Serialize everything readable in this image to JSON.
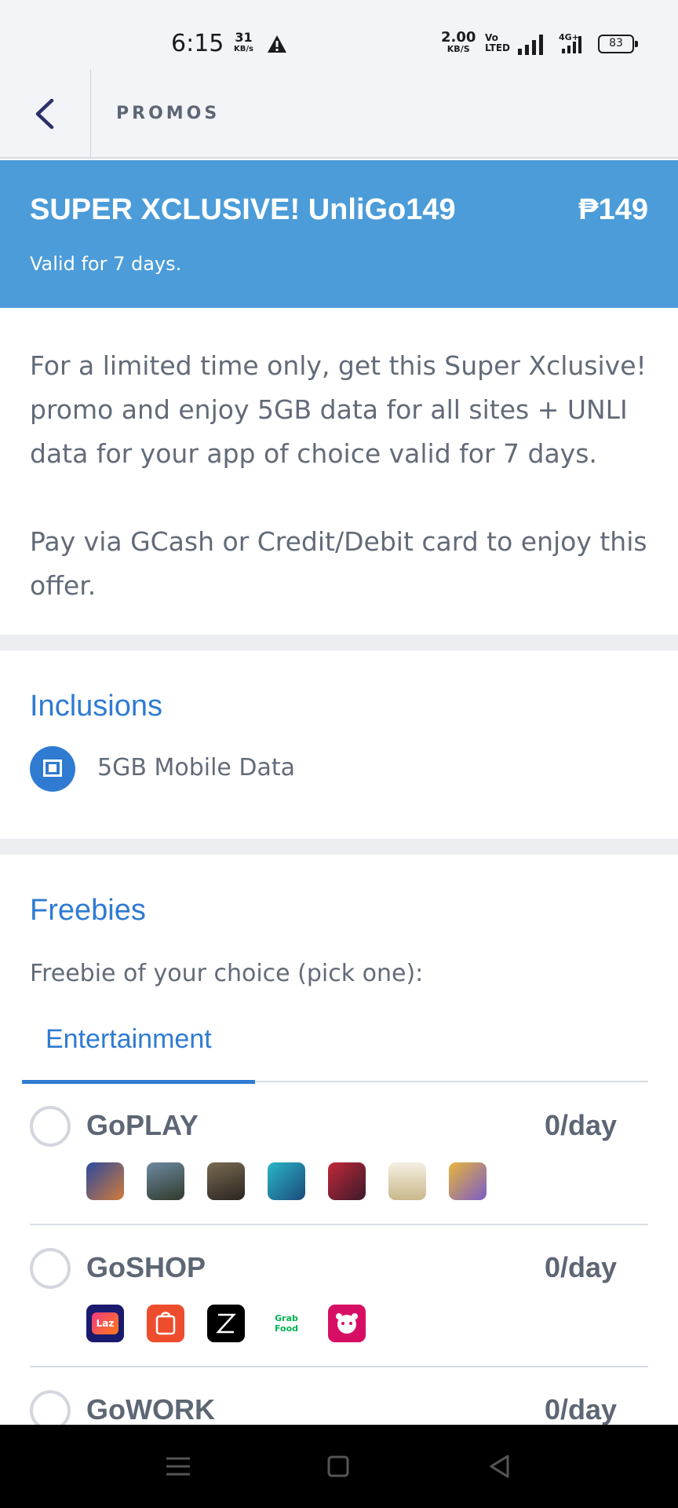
{
  "status_bar": {
    "time": "6:15",
    "speed_value": "31",
    "speed_unit": "KB/s",
    "net_value": "2.00",
    "net_unit": "KB/S",
    "volte_line1": "Vo",
    "volte_line2": "LTED",
    "network_type": "4G+",
    "battery": "83"
  },
  "header": {
    "title": "PROMOS",
    "back_icon": "chevron-left-icon"
  },
  "promo": {
    "title": "SUPER XCLUSIVE! UnliGo149",
    "price": "₱149",
    "validity": "Valid for 7 days.",
    "banner_color": "#4b9cd9"
  },
  "description": {
    "paragraph1": "For a limited time only, get this Super Xclusive! promo and enjoy 5GB data for all sites + UNLI data for your app of choice valid for 7 days.",
    "paragraph2": "Pay via GCash or Credit/Debit card to enjoy this offer."
  },
  "inclusions": {
    "title": "Inclusions",
    "items": [
      {
        "label": "5GB Mobile Data",
        "icon": "mobile-data-icon"
      }
    ]
  },
  "freebies": {
    "title": "Freebies",
    "subtitle": "Freebie of your choice (pick one):",
    "tabs": [
      {
        "label": "Entertainment",
        "active": true
      }
    ],
    "options": [
      {
        "name": "GoPLAY",
        "rate": "0/day",
        "apps": [
          "mobile-legends-icon",
          "pubg-icon",
          "call-of-duty-icon",
          "league-wild-rift-icon",
          "free-fire-icon",
          "genshin-impact-icon",
          "anime-game-icon"
        ]
      },
      {
        "name": "GoSHOP",
        "rate": "0/day",
        "apps": [
          "lazada-icon",
          "shopee-icon",
          "zalora-icon",
          "grabfood-icon",
          "foodpanda-icon"
        ],
        "app_labels": {
          "lazada": "Laz",
          "grabfood_line1": "Grab",
          "grabfood_line2": "Food"
        }
      },
      {
        "name": "GoWORK",
        "rate": "0/day",
        "apps": []
      }
    ]
  },
  "accent_color": "#2f7bd2"
}
